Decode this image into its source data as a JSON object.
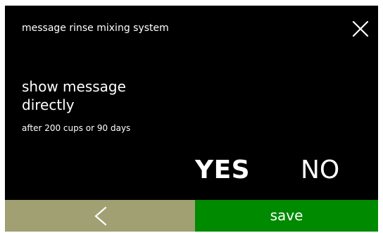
{
  "header": {
    "title": "message rinse mixing system",
    "close_icon": "close-icon"
  },
  "content": {
    "main_line1": "show message",
    "main_line2": "directly",
    "subtitle": "after 200 cups or 90 days"
  },
  "options": {
    "yes_label": "YES",
    "no_label": "NO",
    "selected": "YES"
  },
  "footer": {
    "back_icon": "chevron-left-icon",
    "save_label": "save"
  },
  "colors": {
    "background": "#000000",
    "text": "#ffffff",
    "back_button": "#a1a072",
    "save_button": "#008a00"
  }
}
